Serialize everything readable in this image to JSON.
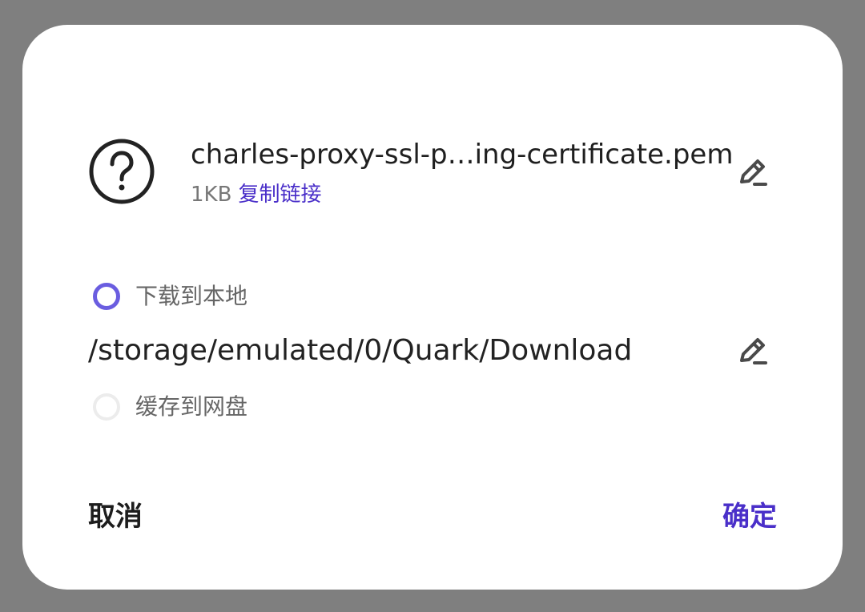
{
  "file": {
    "icon": "question-mark-icon",
    "name": "charles-proxy-ssl-p…ing-certificate.pem",
    "size": "1KB",
    "copy_link_label": "复制链接"
  },
  "options": {
    "local": {
      "label": "下载到本地",
      "selected": true
    },
    "cloud": {
      "label": "缓存到网盘",
      "selected": false
    }
  },
  "path": "/storage/emulated/0/Quark/Download",
  "buttons": {
    "cancel_label": "取消",
    "confirm_label": "确定"
  },
  "colors": {
    "accent": "#4a2fc9",
    "radio_selected": "#6a5de0",
    "overlay": "#7f7f7f"
  }
}
